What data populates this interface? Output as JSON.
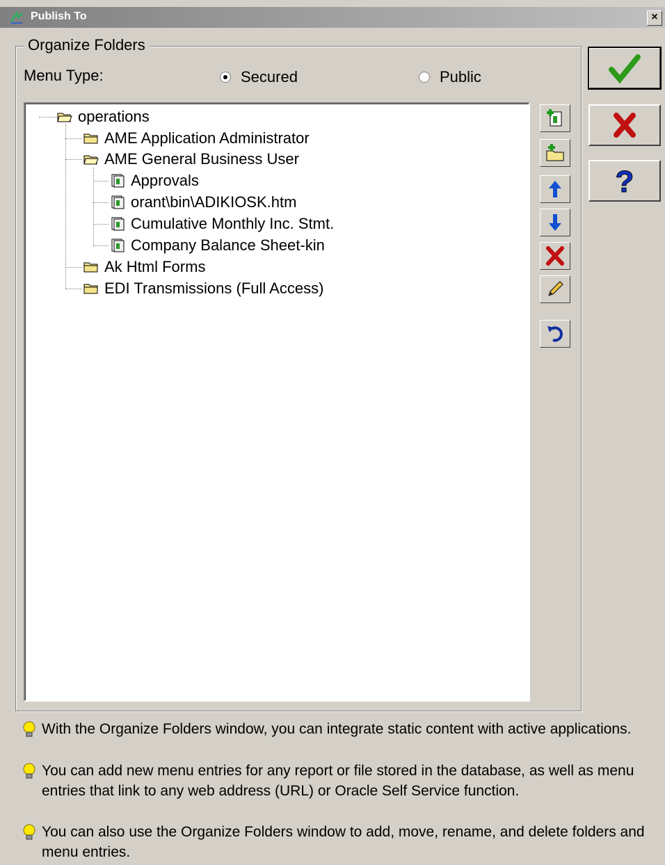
{
  "window": {
    "title": "Publish To",
    "close_glyph": "×",
    "title_icon": "app-icon"
  },
  "group": {
    "legend": "Organize Folders",
    "menu_type_label": "Menu Type:",
    "radio_secured": "Secured",
    "radio_public": "Public",
    "selected": "Secured"
  },
  "tree": {
    "items": [
      {
        "label": "operations",
        "icon": "folder-open-icon",
        "level": 0
      },
      {
        "label": "AME Application Administrator",
        "icon": "folder-icon",
        "level": 1
      },
      {
        "label": "AME General Business User",
        "icon": "folder-open-icon",
        "level": 1
      },
      {
        "label": "Approvals",
        "icon": "document-icon",
        "level": 2
      },
      {
        "label": "orant\\bin\\ADIKIOSK.htm",
        "icon": "document-icon",
        "level": 2
      },
      {
        "label": "Cumulative Monthly Inc. Stmt.",
        "icon": "document-icon",
        "level": 2
      },
      {
        "label": "Company Balance Sheet-kin",
        "icon": "document-icon",
        "level": 2
      },
      {
        "label": "Ak Html Forms",
        "icon": "folder-icon",
        "level": 1
      },
      {
        "label": "EDI Transmissions (Full Access)",
        "icon": "folder-icon",
        "level": 1
      }
    ]
  },
  "toolbar": {
    "buttons": [
      "add-entry-icon",
      "add-folder-icon",
      "move-up-icon",
      "move-down-icon",
      "delete-icon",
      "rename-icon",
      "undo-icon"
    ]
  },
  "actions": {
    "ok": "ok-checkmark-icon",
    "cancel": "cancel-x-icon",
    "help": "help-question-icon"
  },
  "hints": [
    "With the Organize Folders window, you can integrate static content with active applications.",
    "You can add new menu entries for any report or file stored in the database, as well as menu entries that link to any web address (URL) or Oracle Self Service function.",
    "You can also use the Organize Folders window to add, move, rename, and delete folders and menu entries."
  ],
  "colors": {
    "face": "#d4d0c8",
    "ok_green": "#2e9a1a",
    "cancel_red": "#c01010",
    "help_blue": "#1030c0",
    "folder_yellow": "#f4e58c"
  }
}
